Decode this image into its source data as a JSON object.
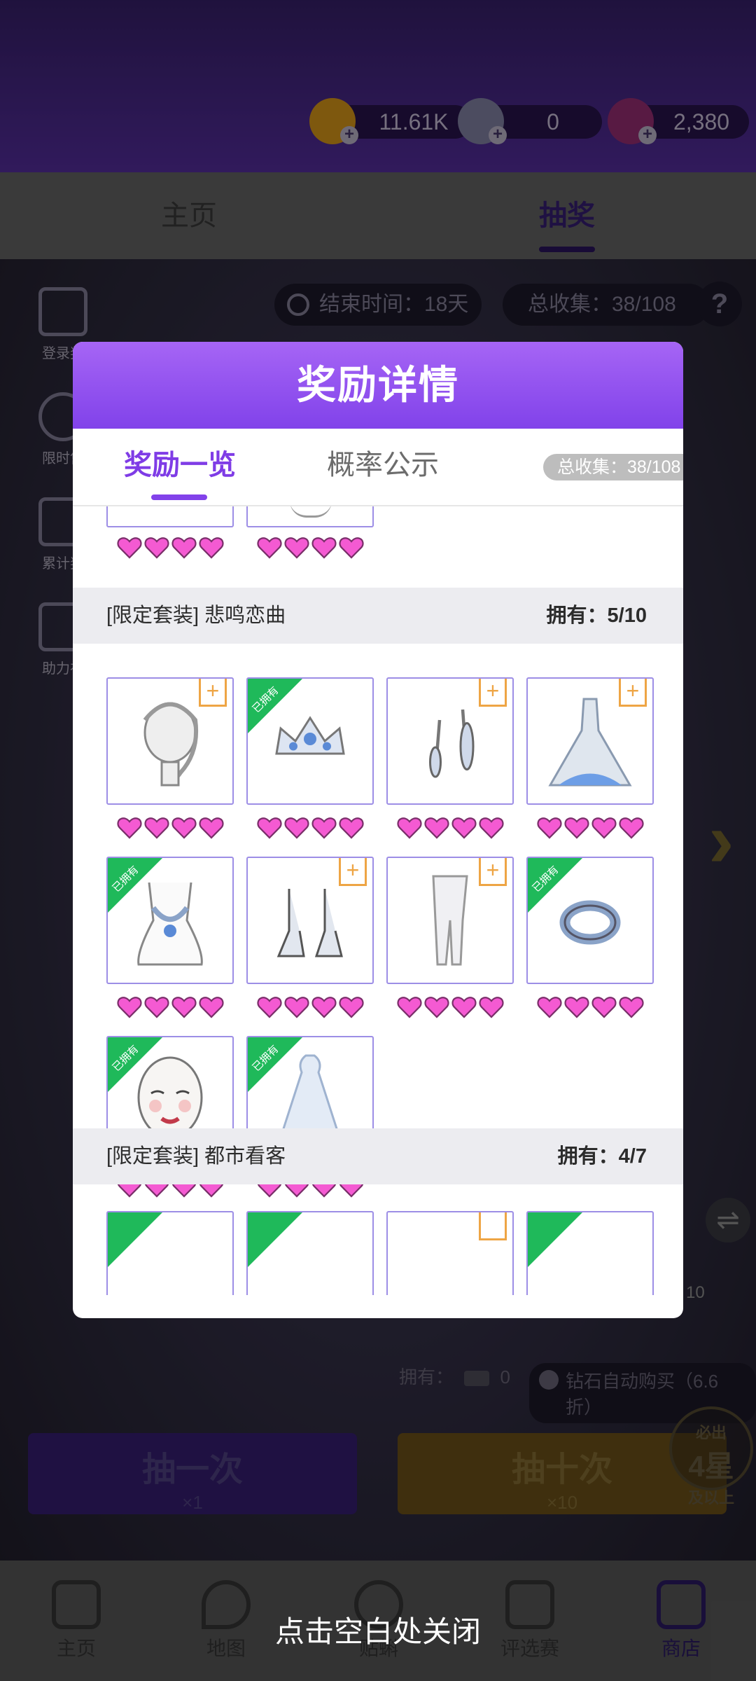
{
  "currency": {
    "coins": "11.61K",
    "diamonds": "0",
    "gems": "2,380"
  },
  "nav_tabs": [
    {
      "label": "主页"
    },
    {
      "label": "抽奖"
    }
  ],
  "event": {
    "end_time": "结束时间：18天",
    "total_collect": "总收集：38/108",
    "help": "?"
  },
  "side_buttons": [
    {
      "label": "登录奖"
    },
    {
      "label": "限时售"
    },
    {
      "label": "累计奖"
    },
    {
      "label": "助力礼"
    }
  ],
  "modal": {
    "title": "奖励详情",
    "tabs": [
      {
        "label": "奖励一览"
      },
      {
        "label": "概率公示"
      }
    ],
    "total_collect": "总收集：38/108",
    "owned_label": "已拥有",
    "add_label": "+",
    "groups": [
      {
        "name": "[限定套装] 悲鸣恋曲",
        "owned": "拥有：5/10"
      },
      {
        "name": "[限定套装] 都市看客",
        "owned": "拥有：4/7"
      }
    ],
    "items": [
      {
        "icon": "hair-icon",
        "owned": false,
        "stars": 4
      },
      {
        "icon": "crown-icon",
        "owned": true,
        "stars": 4
      },
      {
        "icon": "earrings-icon",
        "owned": false,
        "stars": 4
      },
      {
        "icon": "gown-icon",
        "owned": false,
        "stars": 4
      },
      {
        "icon": "necklace-icon",
        "owned": true,
        "stars": 4
      },
      {
        "icon": "heels-icon",
        "owned": false,
        "stars": 4
      },
      {
        "icon": "stockings-icon",
        "owned": false,
        "stars": 4
      },
      {
        "icon": "bracelet-icon",
        "owned": true,
        "stars": 4
      },
      {
        "icon": "makeup-icon",
        "owned": true,
        "stars": 4
      },
      {
        "icon": "veil-icon",
        "owned": true,
        "stars": 4
      }
    ]
  },
  "draw": {
    "owned_label": "拥有：",
    "ticket_count": "0",
    "auto_buy": "钻石自动购买（6.6折）",
    "once_label": "抽一次",
    "once_cost": "×1",
    "ten_label": "抽十次",
    "ten_cost": "×10",
    "guarantee_top": "必出",
    "guarantee_mid": "4星",
    "guarantee_bottom": "及以上",
    "stack_count": "10"
  },
  "bottom_nav": [
    {
      "label": "主页"
    },
    {
      "label": "地图"
    },
    {
      "label": "贴蝌"
    },
    {
      "label": "评选赛"
    },
    {
      "label": "商店"
    }
  ],
  "close_hint": "点击空白处关闭",
  "colors": {
    "accent": "#8242ea",
    "owned_green": "#1fb95a",
    "heart_pink": "#f45ad2",
    "add_orange": "#eea545"
  }
}
